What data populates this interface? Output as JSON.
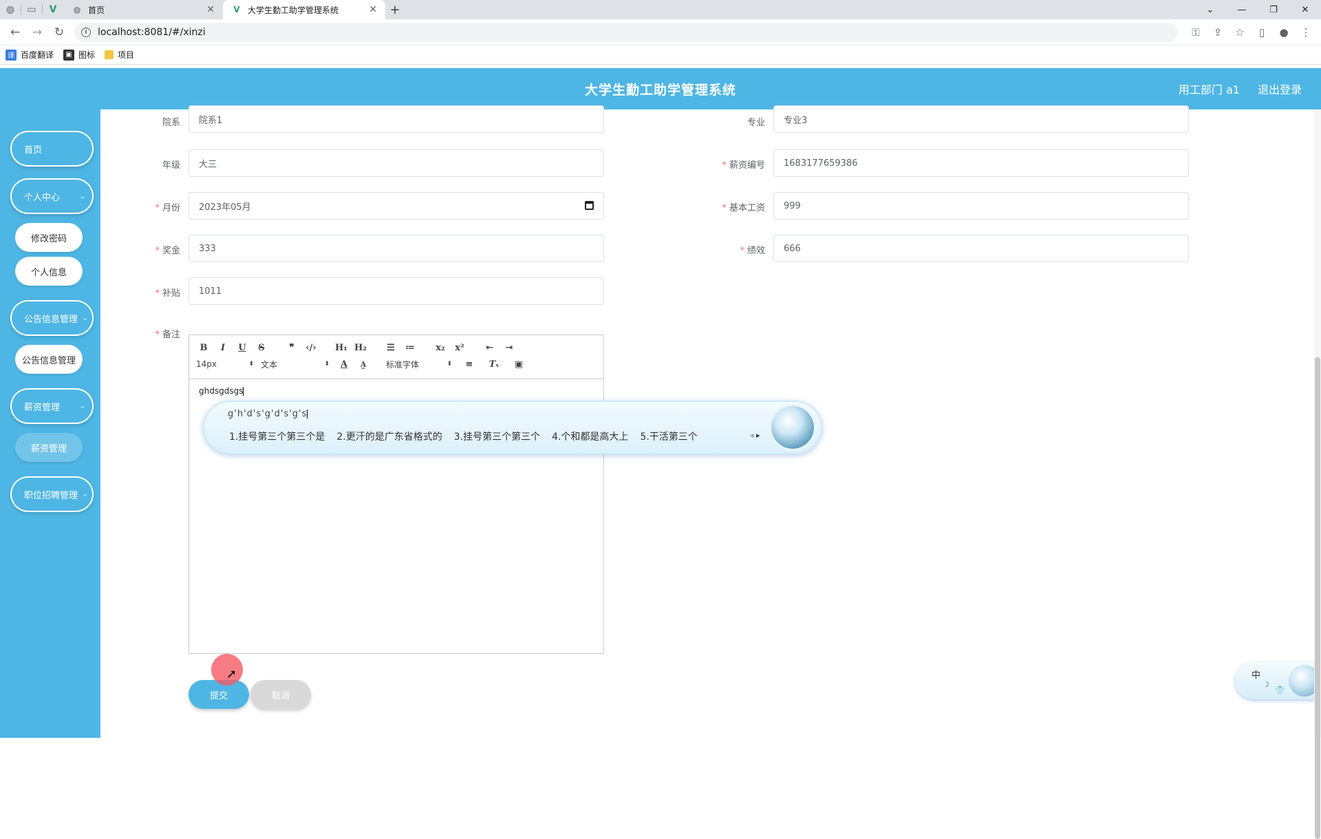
{
  "browser": {
    "tabs": [
      {
        "title": "首页",
        "active": false
      },
      {
        "title": "大学生勤工助学管理系统",
        "active": true
      }
    ],
    "url": "localhost:8081/#/xinzi",
    "bookmarks": [
      "百度翻译",
      "图标",
      "项目"
    ]
  },
  "header": {
    "title": "大学生勤工助学管理系统",
    "user": "用工部门 a1",
    "logout": "退出登录"
  },
  "sidebar": {
    "items": [
      {
        "label": "首页"
      },
      {
        "label": "个人中心"
      },
      {
        "label": "修改密码"
      },
      {
        "label": "个人信息"
      },
      {
        "label": "公告信息管理"
      },
      {
        "label": "公告信息管理"
      },
      {
        "label": "薪资管理"
      },
      {
        "label": "薪资管理"
      },
      {
        "label": "职位招聘管理"
      }
    ]
  },
  "form": {
    "department": {
      "label": "院系",
      "value": "院系1"
    },
    "major": {
      "label": "专业",
      "value": "专业3"
    },
    "grade": {
      "label": "年级",
      "value": "大三"
    },
    "salary_no": {
      "label": "薪资编号",
      "value": "1683177659386"
    },
    "month": {
      "label": "月份",
      "value": "2023年05月"
    },
    "base_salary": {
      "label": "基本工资",
      "value": "999"
    },
    "bonus": {
      "label": "奖金",
      "value": "333"
    },
    "performance": {
      "label": "绩效",
      "value": "666"
    },
    "allowance": {
      "label": "补贴",
      "value": "1011"
    },
    "remark": {
      "label": "备注",
      "content": "ghdsgdsgs"
    }
  },
  "editor": {
    "font_size": "14px",
    "format": "文本",
    "font_family": "标准字体"
  },
  "ime": {
    "composition": "g'h'd's'g'd's'g's",
    "candidates": [
      "1.挂号第三个第三个是",
      "2.更汗的是广东省格式的",
      "3.挂号第三个第三个",
      "4.个和都是高大上",
      "5.干活第三个"
    ],
    "mode": "中"
  },
  "buttons": {
    "submit": "提交",
    "cancel": "取消"
  },
  "colors": {
    "primary": "#4eb6e4",
    "required": "#f56c6c"
  }
}
